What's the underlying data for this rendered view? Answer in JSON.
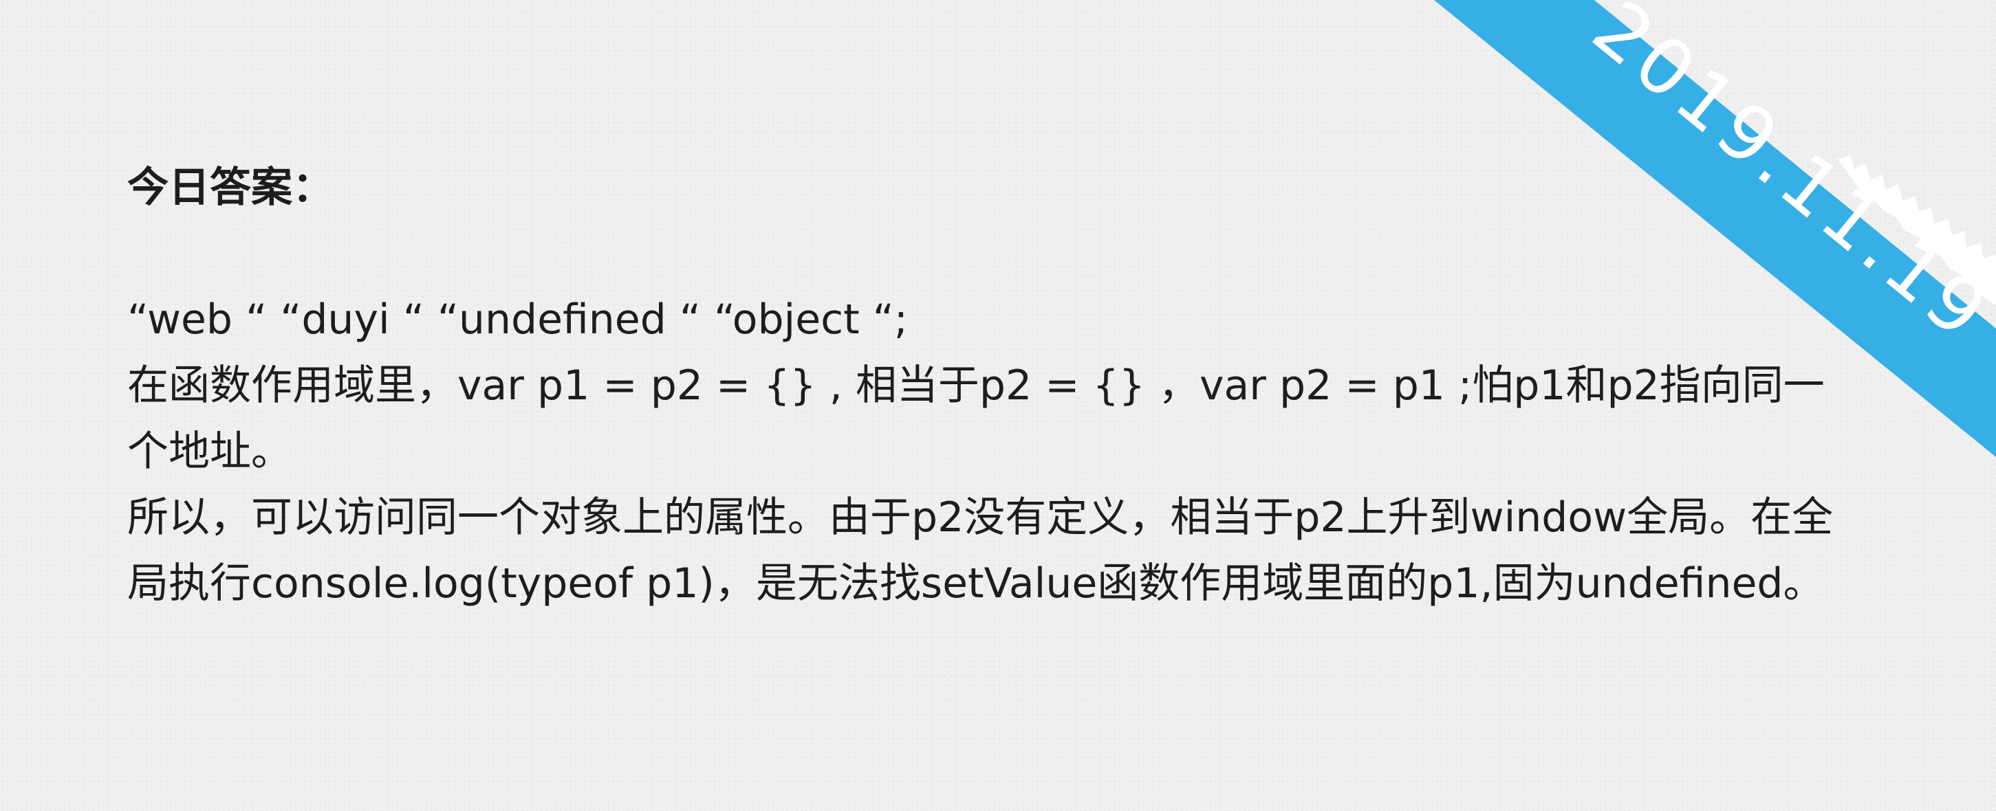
{
  "heading": "今日答案：",
  "answer_lines": [
    "“web “ “duyi “ “undefined “ “object “;",
    "在函数作用域里，var p1 = p2 = {} , 相当于p2 = {} ，var p2 = p1 ;怕p1和p2指向同一个地址。",
    "所以，可以访问同一个对象上的属性。由于p2没有定义，相当于p2上升到window全局。在全局执行console.log(typeof p1)，是无法找setValue函数作用域里面的p1,固为undefined。"
  ],
  "ribbon": {
    "date": "2019.11.19",
    "color": "#36aee6",
    "torn_color": "#ffffff"
  }
}
